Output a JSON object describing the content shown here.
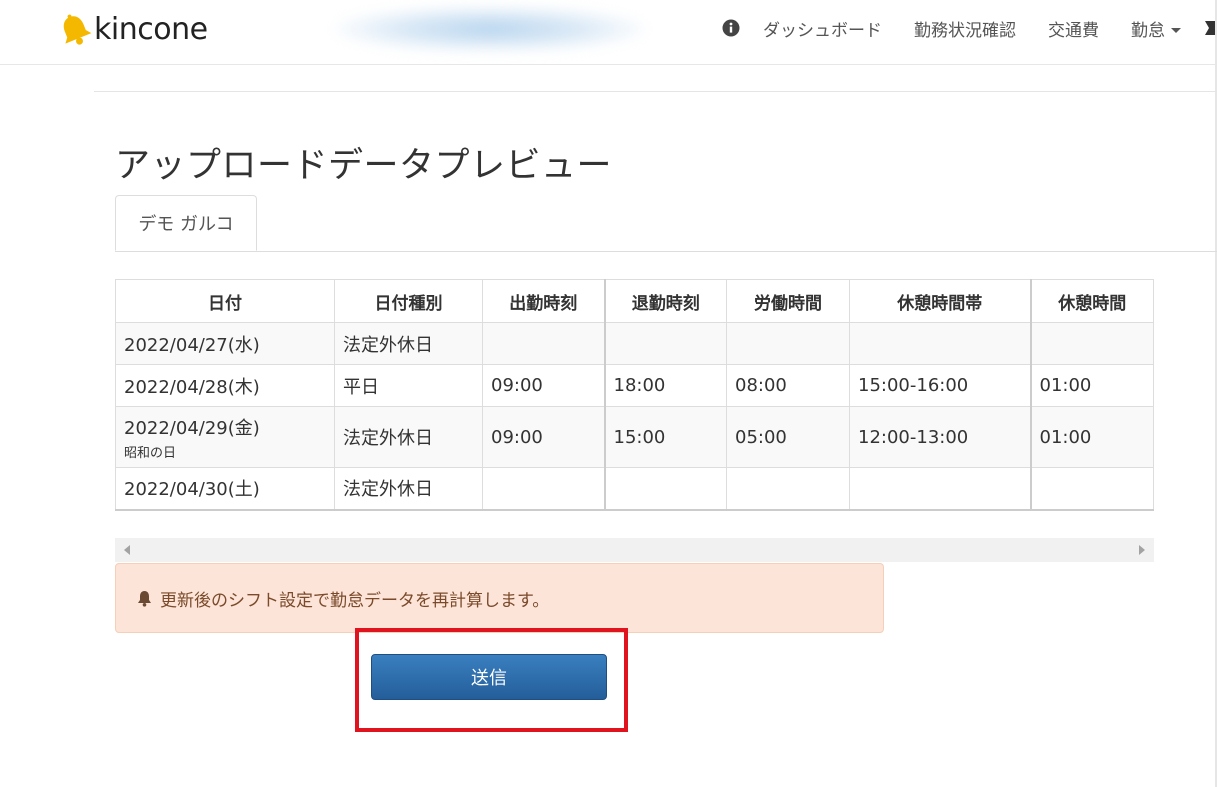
{
  "brand": {
    "name": "kincone",
    "bell_color": "#f5b800"
  },
  "nav": {
    "items": [
      {
        "label": "ダッシュボード"
      },
      {
        "label": "勤務状況確認"
      },
      {
        "label": "交通費"
      },
      {
        "label": "勤怠"
      }
    ],
    "info_icon": "info-circle-icon",
    "dropdown_icon": "caret-down-icon"
  },
  "page": {
    "title": "アップロードデータプレビュー",
    "tabs": [
      {
        "label": "デモ ガルコ",
        "active": true
      }
    ]
  },
  "table": {
    "headers": [
      "日付",
      "日付種別",
      "出勤時刻",
      "退勤時刻",
      "労働時間",
      "休憩時間帯",
      "休憩時間"
    ],
    "rows": [
      {
        "date": "2022/04/27(水)",
        "note": "",
        "type": "法定外休日",
        "in": "",
        "out": "",
        "work": "",
        "break_range": "",
        "break": ""
      },
      {
        "date": "2022/04/28(木)",
        "note": "",
        "type": "平日",
        "in": "09:00",
        "out": "18:00",
        "work": "08:00",
        "break_range": "15:00-16:00",
        "break": "01:00"
      },
      {
        "date": "2022/04/29(金)",
        "note": "昭和の日",
        "type": "法定外休日",
        "in": "09:00",
        "out": "15:00",
        "work": "05:00",
        "break_range": "12:00-13:00",
        "break": "01:00"
      },
      {
        "date": "2022/04/30(土)",
        "note": "",
        "type": "法定外休日",
        "in": "",
        "out": "",
        "work": "",
        "break_range": "",
        "break": ""
      }
    ]
  },
  "alert": {
    "icon": "bell-icon",
    "text": "更新後のシフト設定で勤怠データを再計算します。",
    "bg_color": "#fce4d8"
  },
  "actions": {
    "submit_label": "送信",
    "submit_color": "#2d6aa8",
    "highlight_color": "#e0141e"
  }
}
